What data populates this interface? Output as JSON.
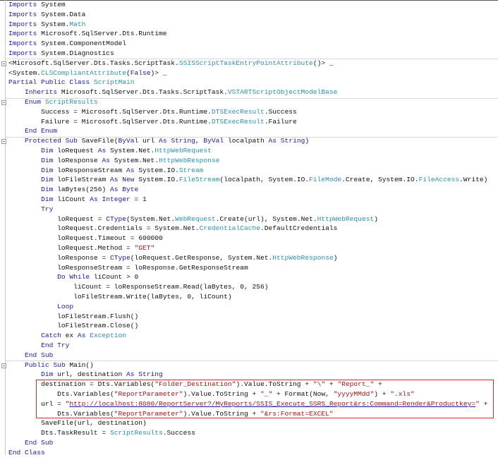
{
  "colors": {
    "keyword": "#1a1aa6",
    "type": "#2b91af",
    "string": "#a31515",
    "highlight_box": "#d9262b"
  },
  "code": {
    "language": "VB.NET",
    "lines": [
      {
        "indent": 0,
        "tokens": [
          [
            "k",
            "Imports"
          ],
          [
            "p",
            " System"
          ]
        ]
      },
      {
        "indent": 0,
        "tokens": [
          [
            "k",
            "Imports"
          ],
          [
            "p",
            " System.Data"
          ]
        ]
      },
      {
        "indent": 0,
        "tokens": [
          [
            "k",
            "Imports"
          ],
          [
            "p",
            " System."
          ],
          [
            "t",
            "Math"
          ]
        ]
      },
      {
        "indent": 0,
        "tokens": [
          [
            "k",
            "Imports"
          ],
          [
            "p",
            " Microsoft.SqlServer.Dts.Runtime"
          ]
        ]
      },
      {
        "indent": 0,
        "tokens": [
          [
            "k",
            "Imports"
          ],
          [
            "p",
            " System.ComponentModel"
          ]
        ]
      },
      {
        "indent": 0,
        "tokens": [
          [
            "k",
            "Imports"
          ],
          [
            "p",
            " System.Diagnostics"
          ]
        ]
      },
      {
        "indent": 0,
        "tokens": [
          [
            "p",
            "<Microsoft.SqlServer.Dts.Tasks.ScriptTask."
          ],
          [
            "t",
            "SSISScriptTaskEntryPointAttribute"
          ],
          [
            "p",
            "()> _"
          ]
        ]
      },
      {
        "indent": 0,
        "tokens": [
          [
            "p",
            "<System."
          ],
          [
            "t",
            "CLSCompliantAttribute"
          ],
          [
            "p",
            "("
          ],
          [
            "k",
            "False"
          ],
          [
            "p",
            ")> _"
          ]
        ]
      },
      {
        "indent": 0,
        "tokens": [
          [
            "k",
            "Partial Public Class"
          ],
          [
            "p",
            " "
          ],
          [
            "t",
            "ScriptMain"
          ]
        ]
      },
      {
        "indent": 4,
        "tokens": [
          [
            "k",
            "Inherits"
          ],
          [
            "p",
            " Microsoft.SqlServer.Dts.Tasks.ScriptTask."
          ],
          [
            "t",
            "VSTARTScriptObjectModelBase"
          ]
        ]
      },
      {
        "indent": 4,
        "tokens": [
          [
            "k",
            "Enum"
          ],
          [
            "p",
            " "
          ],
          [
            "t",
            "ScriptResults"
          ]
        ]
      },
      {
        "indent": 8,
        "tokens": [
          [
            "p",
            "Success = Microsoft.SqlServer.Dts.Runtime."
          ],
          [
            "t",
            "DTSExecResult"
          ],
          [
            "p",
            ".Success"
          ]
        ]
      },
      {
        "indent": 8,
        "tokens": [
          [
            "p",
            "Failure = Microsoft.SqlServer.Dts.Runtime."
          ],
          [
            "t",
            "DTSExecResult"
          ],
          [
            "p",
            ".Failure"
          ]
        ]
      },
      {
        "indent": 4,
        "tokens": [
          [
            "k",
            "End Enum"
          ]
        ]
      },
      {
        "indent": 4,
        "tokens": [
          [
            "k",
            "Protected Sub"
          ],
          [
            "p",
            " SaveFile("
          ],
          [
            "k",
            "ByVal"
          ],
          [
            "p",
            " url "
          ],
          [
            "k",
            "As String"
          ],
          [
            "p",
            ", "
          ],
          [
            "k",
            "ByVal"
          ],
          [
            "p",
            " localpath "
          ],
          [
            "k",
            "As String"
          ],
          [
            "p",
            ")"
          ]
        ]
      },
      {
        "indent": 8,
        "tokens": [
          [
            "k",
            "Dim"
          ],
          [
            "p",
            " loRequest "
          ],
          [
            "k",
            "As"
          ],
          [
            "p",
            " System.Net."
          ],
          [
            "t",
            "HttpWebRequest"
          ]
        ]
      },
      {
        "indent": 8,
        "tokens": [
          [
            "k",
            "Dim"
          ],
          [
            "p",
            " loResponse "
          ],
          [
            "k",
            "As"
          ],
          [
            "p",
            " System.Net."
          ],
          [
            "t",
            "HttpWebResponse"
          ]
        ]
      },
      {
        "indent": 8,
        "tokens": [
          [
            "k",
            "Dim"
          ],
          [
            "p",
            " loResponseStream "
          ],
          [
            "k",
            "As"
          ],
          [
            "p",
            " System.IO."
          ],
          [
            "t",
            "Stream"
          ]
        ]
      },
      {
        "indent": 8,
        "tokens": [
          [
            "k",
            "Dim"
          ],
          [
            "p",
            " loFileStream "
          ],
          [
            "k",
            "As New"
          ],
          [
            "p",
            " System.IO."
          ],
          [
            "t",
            "FileStream"
          ],
          [
            "p",
            "(localpath, System.IO."
          ],
          [
            "t",
            "FileMode"
          ],
          [
            "p",
            ".Create, System.IO."
          ],
          [
            "t",
            "FileAccess"
          ],
          [
            "p",
            ".Write)"
          ]
        ]
      },
      {
        "indent": 8,
        "tokens": [
          [
            "k",
            "Dim"
          ],
          [
            "p",
            " laBytes(256) "
          ],
          [
            "k",
            "As Byte"
          ]
        ]
      },
      {
        "indent": 8,
        "tokens": [
          [
            "k",
            "Dim"
          ],
          [
            "p",
            " liCount "
          ],
          [
            "k",
            "As Integer"
          ],
          [
            "p",
            " = 1"
          ]
        ]
      },
      {
        "indent": 8,
        "tokens": [
          [
            "k",
            "Try"
          ]
        ]
      },
      {
        "indent": 12,
        "tokens": [
          [
            "p",
            "loRequest = "
          ],
          [
            "k",
            "CType"
          ],
          [
            "p",
            "(System.Net."
          ],
          [
            "t",
            "WebRequest"
          ],
          [
            "p",
            ".Create(url), System.Net."
          ],
          [
            "t",
            "HttpWebRequest"
          ],
          [
            "p",
            ")"
          ]
        ]
      },
      {
        "indent": 12,
        "tokens": [
          [
            "p",
            "loRequest.Credentials = System.Net."
          ],
          [
            "t",
            "CredentialCache"
          ],
          [
            "p",
            ".DefaultCredentials"
          ]
        ]
      },
      {
        "indent": 12,
        "tokens": [
          [
            "p",
            "loRequest.Timeout = 600000"
          ]
        ]
      },
      {
        "indent": 12,
        "tokens": [
          [
            "p",
            "loRequest.Method = "
          ],
          [
            "s",
            "\"GET\""
          ]
        ]
      },
      {
        "indent": 12,
        "tokens": [
          [
            "p",
            "loResponse = "
          ],
          [
            "k",
            "CType"
          ],
          [
            "p",
            "(loRequest.GetResponse, System.Net."
          ],
          [
            "t",
            "HttpWebResponse"
          ],
          [
            "p",
            ")"
          ]
        ]
      },
      {
        "indent": 12,
        "tokens": [
          [
            "p",
            "loResponseStream = loResponse.GetResponseStream"
          ]
        ]
      },
      {
        "indent": 12,
        "tokens": [
          [
            "k",
            "Do While"
          ],
          [
            "p",
            " liCount > 0"
          ]
        ]
      },
      {
        "indent": 16,
        "tokens": [
          [
            "p",
            "liCount = loResponseStream.Read(laBytes, 0, 256)"
          ]
        ]
      },
      {
        "indent": 16,
        "tokens": [
          [
            "p",
            "loFileStream.Write(laBytes, 0, liCount)"
          ]
        ]
      },
      {
        "indent": 12,
        "tokens": [
          [
            "k",
            "Loop"
          ]
        ]
      },
      {
        "indent": 12,
        "tokens": [
          [
            "p",
            "loFileStream.Flush()"
          ]
        ]
      },
      {
        "indent": 12,
        "tokens": [
          [
            "p",
            "loFileStream.Close()"
          ]
        ]
      },
      {
        "indent": 8,
        "tokens": [
          [
            "k",
            "Catch"
          ],
          [
            "p",
            " ex "
          ],
          [
            "k",
            "As"
          ],
          [
            "p",
            " "
          ],
          [
            "t",
            "Exception"
          ]
        ]
      },
      {
        "indent": 8,
        "tokens": [
          [
            "k",
            "End Try"
          ]
        ]
      },
      {
        "indent": 4,
        "tokens": [
          [
            "k",
            "End Sub"
          ]
        ]
      },
      {
        "indent": 4,
        "tokens": [
          [
            "k",
            "Public Sub"
          ],
          [
            "p",
            " Main()"
          ]
        ]
      },
      {
        "indent": 8,
        "tokens": [
          [
            "k",
            "Dim"
          ],
          [
            "p",
            " url, destination "
          ],
          [
            "k",
            "As String"
          ]
        ]
      },
      {
        "indent": 8,
        "tokens": [
          [
            "p",
            "destination = Dts.Variables("
          ],
          [
            "s",
            "\"Folder_Destination\""
          ],
          [
            "p",
            ").Value.ToString + "
          ],
          [
            "s",
            "\"\\\""
          ],
          [
            "p",
            " + "
          ],
          [
            "s",
            "\"Report_\""
          ],
          [
            "p",
            " +"
          ]
        ]
      },
      {
        "indent": 12,
        "tokens": [
          [
            "p",
            "Dts.Variables("
          ],
          [
            "s",
            "\"ReportParameter\""
          ],
          [
            "p",
            ").Value.ToString + "
          ],
          [
            "s",
            "\"_\""
          ],
          [
            "p",
            " + Format(Now, "
          ],
          [
            "s",
            "\"yyyyMMdd\""
          ],
          [
            "p",
            ") + "
          ],
          [
            "s",
            "\".xls\""
          ]
        ]
      },
      {
        "indent": 8,
        "tokens": [
          [
            "p",
            "url = "
          ],
          [
            "s",
            "\""
          ],
          [
            "u",
            "http://localhost:8080/ReportServer?/MyReports/SSIS_Execute_SSRS_Report&rs:Command=Render&Productkey="
          ],
          [
            "s",
            "\""
          ],
          [
            "p",
            " +"
          ]
        ]
      },
      {
        "indent": 12,
        "tokens": [
          [
            "p",
            "Dts.Variables("
          ],
          [
            "s",
            "\"ReportParameter\""
          ],
          [
            "p",
            ").Value.ToString + "
          ],
          [
            "s",
            "\"&rs:Format=EXCEL\""
          ]
        ]
      },
      {
        "indent": 8,
        "tokens": [
          [
            "p",
            "SaveFile(url, destination)"
          ]
        ]
      },
      {
        "indent": 8,
        "tokens": [
          [
            "p",
            "Dts.TaskResult = "
          ],
          [
            "t",
            "ScriptResults"
          ],
          [
            "p",
            ".Success"
          ]
        ]
      },
      {
        "indent": 4,
        "tokens": [
          [
            "k",
            "End Sub"
          ]
        ]
      },
      {
        "indent": 0,
        "tokens": [
          [
            "k",
            "End Class"
          ]
        ]
      }
    ],
    "fold_markers_at_lines": [
      7,
      11,
      15,
      38
    ],
    "separators_after_lines": [
      6,
      10,
      14,
      37
    ],
    "highlighted_lines": [
      40,
      43
    ]
  }
}
